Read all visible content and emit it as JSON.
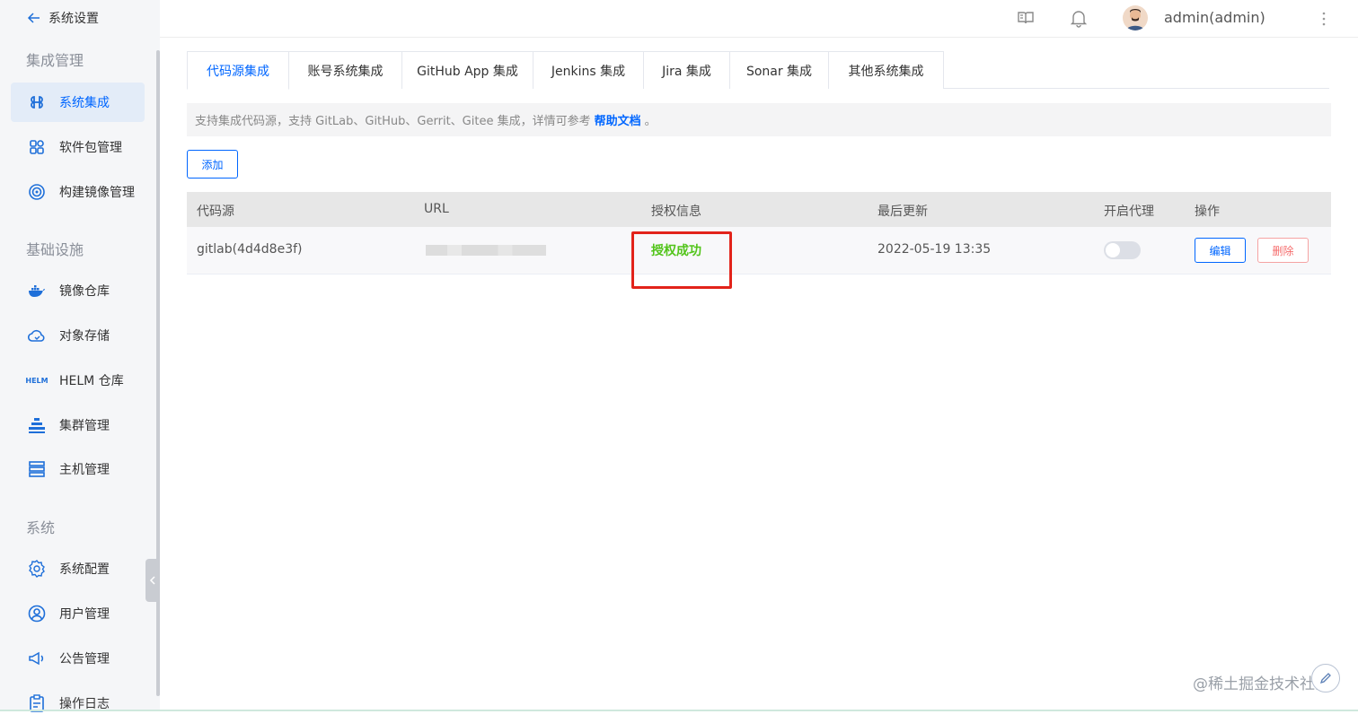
{
  "sidebar": {
    "back_label": "系统设置",
    "groups": [
      {
        "title": "集成管理"
      },
      {
        "title": "基础设施"
      },
      {
        "title": "系统"
      }
    ],
    "items": [
      {
        "label": "系统集成",
        "icon": "command-icon",
        "active": true
      },
      {
        "label": "软件包管理",
        "icon": "grid-icon"
      },
      {
        "label": "构建镜像管理",
        "icon": "target-icon"
      },
      {
        "label": "镜像仓库",
        "icon": "docker-icon"
      },
      {
        "label": "对象存储",
        "icon": "cloud-icon"
      },
      {
        "label": "HELM 仓库",
        "icon": "helm-icon",
        "icon_text": "HELM"
      },
      {
        "label": "集群管理",
        "icon": "cluster-icon"
      },
      {
        "label": "主机管理",
        "icon": "server-icon"
      },
      {
        "label": "系统配置",
        "icon": "settings-icon"
      },
      {
        "label": "用户管理",
        "icon": "user-icon"
      },
      {
        "label": "公告管理",
        "icon": "megaphone-icon"
      },
      {
        "label": "操作日志",
        "icon": "clipboard-icon"
      }
    ]
  },
  "header": {
    "username": "admin(admin)"
  },
  "tabs": [
    {
      "label": "代码源集成",
      "active": true
    },
    {
      "label": "账号系统集成"
    },
    {
      "label": "GitHub App 集成"
    },
    {
      "label": "Jenkins 集成"
    },
    {
      "label": "Jira 集成"
    },
    {
      "label": "Sonar 集成"
    },
    {
      "label": "其他系统集成"
    }
  ],
  "info": {
    "text": "支持集成代码源，支持 GitLab、GitHub、Gerrit、Gitee 集成，详情可参考",
    "link": "帮助文档",
    "suffix": "。"
  },
  "add_label": "添加",
  "table": {
    "columns": [
      "代码源",
      "URL",
      "授权信息",
      "最后更新",
      "开启代理",
      "操作"
    ],
    "rows": [
      {
        "source": "gitlab(4d4d8e3f)",
        "auth": "授权成功",
        "updated": "2022-05-19 13:35",
        "proxy_enabled": false,
        "edit": "编辑",
        "delete": "删除"
      }
    ]
  },
  "watermark": "@稀土掘金技术社区",
  "colors": {
    "accent": "#0066ff",
    "success": "#52c41a",
    "danger": "#f56c6c",
    "highlight": "#e2231a"
  }
}
